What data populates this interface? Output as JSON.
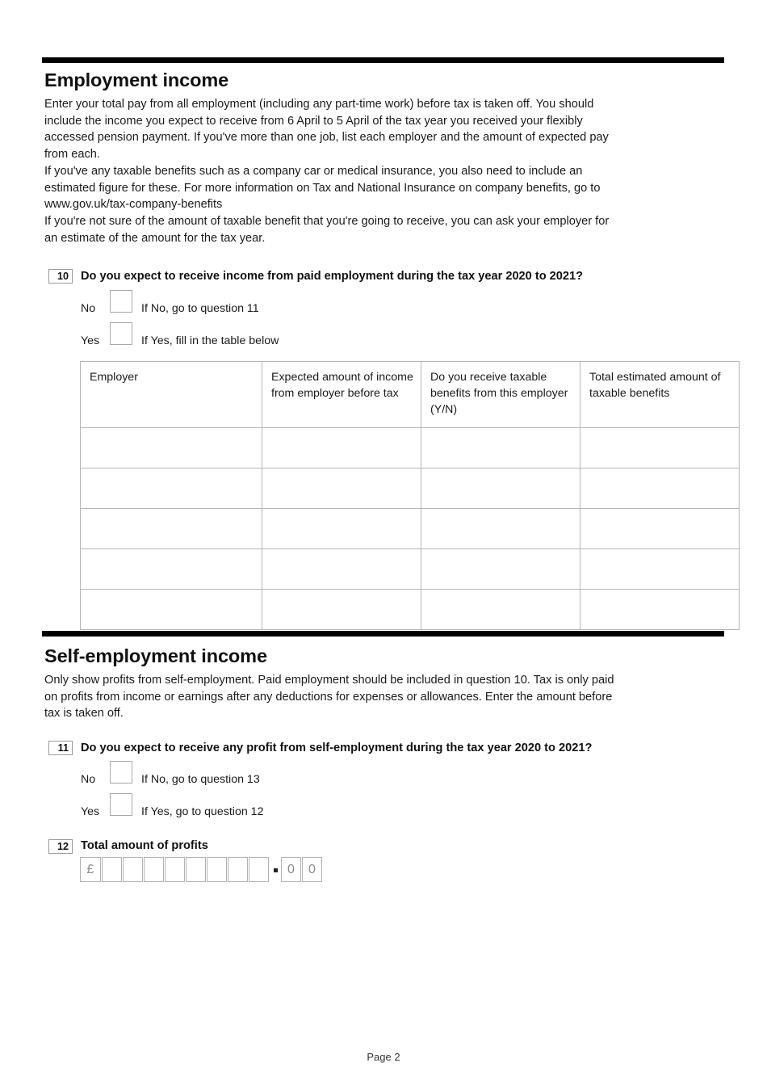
{
  "document": {
    "footer_text": "Page 2"
  },
  "sections": [
    {
      "title": "Employment income",
      "paragraphs": [
        "Enter your total pay from all employment (including any part-time work) before tax is taken off. You should include the income you expect to receive from 6 April to 5 April of the tax year you received your flexibly accessed pension payment. If you've more than one job, list each employer and the amount of expected pay from each.",
        "If you've any taxable benefits such as a company car or medical insurance, you also need to include an estimated figure for these. For more information on Tax and National Insurance on company benefits, go to www.gov.uk/tax-company-benefits",
        "If you're not sure of the amount of taxable benefit that you're going to receive, you can ask your employer for an estimate of the amount for the tax year."
      ]
    },
    {
      "title": "Self-employment income",
      "paragraphs": [
        "Only show profits from self-employment. Paid employment should be included in question 10. Tax is only paid on profits from income or earnings after any deductions for expenses or allowances. Enter the amount before tax is taken off."
      ]
    }
  ],
  "question_10": {
    "number": "10",
    "text": "Do you expect to receive income from paid employment during the tax year 2020 to 2021?",
    "options": [
      {
        "label": "No",
        "hint": "If No, go to question 11"
      },
      {
        "label": "Yes",
        "hint": "If Yes, fill in the table below"
      }
    ]
  },
  "employment_table": {
    "headers": [
      "Employer",
      "Expected amount of income from employer before tax",
      "Do you receive taxable benefits from this employer (Y/N)",
      "Total estimated amount of taxable benefits"
    ],
    "blank_row_count": 5,
    "rows": [
      [
        "",
        "",
        "",
        ""
      ],
      [
        "",
        "",
        "",
        ""
      ],
      [
        "",
        "",
        "",
        ""
      ],
      [
        "",
        "",
        "",
        ""
      ],
      [
        "",
        "",
        "",
        ""
      ]
    ]
  },
  "question_11": {
    "number": "11",
    "text": "Do you expect to receive any profit from self-employment during the tax year 2020 to 2021?",
    "options": [
      {
        "label": "No",
        "hint": "If No, go to question 13"
      },
      {
        "label": "Yes",
        "hint": "If Yes, go to question 12"
      }
    ]
  },
  "question_12": {
    "number": "12",
    "text": "Total amount of profits",
    "amount_field": {
      "currency_symbol": "£",
      "whole_digits": [
        "",
        "",
        "",
        "",
        "",
        "",
        "",
        ""
      ],
      "decimal_separator": ".",
      "decimal_digits": [
        "0",
        "0"
      ]
    }
  },
  "colors": {
    "rule": "#000000",
    "text": "#1a1a1a",
    "box_border": "#a8a8a8",
    "table_border": "#b6b6b6"
  }
}
